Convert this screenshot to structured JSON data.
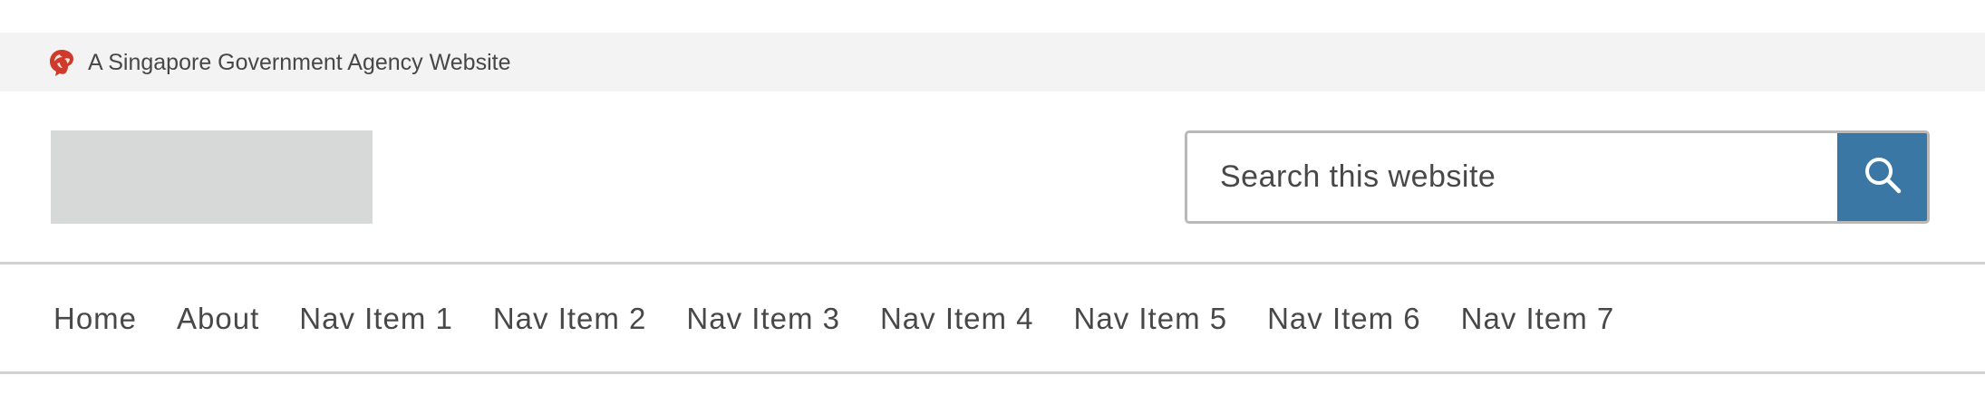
{
  "masthead": {
    "text": "A Singapore Government Agency Website",
    "icon": "singapore-lion-head-icon",
    "icon_color": "#d03a2b",
    "background": "#f3f3f3"
  },
  "header": {
    "logo": "logo-placeholder"
  },
  "search": {
    "placeholder": "Search this website",
    "value": "",
    "button_icon": "search-icon",
    "button_color": "#3b77a5"
  },
  "nav": {
    "items": [
      {
        "label": "Home"
      },
      {
        "label": "About"
      },
      {
        "label": "Nav Item 1"
      },
      {
        "label": "Nav Item 2"
      },
      {
        "label": "Nav Item 3"
      },
      {
        "label": "Nav Item 4"
      },
      {
        "label": "Nav Item 5"
      },
      {
        "label": "Nav Item 6"
      },
      {
        "label": "Nav Item 7"
      }
    ]
  }
}
